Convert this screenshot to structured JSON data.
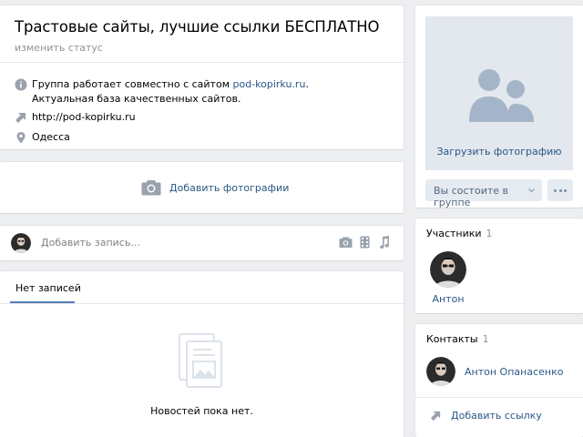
{
  "header": {
    "title": "Трастовые сайты, лучшие ссылки БЕСПЛАТНО",
    "status_link": "изменить статус",
    "description_prefix": "Группа работает совместно с сайтом ",
    "description_link": "pod-kopirku.ru",
    "description_suffix": ". Актуальная база качественных сайтов.",
    "website": "http://pod-kopirku.ru",
    "location": "Одесса"
  },
  "photos": {
    "add_label": "Добавить фотографии"
  },
  "postbox": {
    "placeholder": "Добавить запись..."
  },
  "wall": {
    "tab_label": "Нет записей",
    "empty_text": "Новостей пока нет."
  },
  "cover": {
    "upload_label": "Загрузить фотографию",
    "member_button": "Вы состоите в группе"
  },
  "members": {
    "title": "Участники",
    "count": "1",
    "items": [
      {
        "name": "Антон"
      }
    ]
  },
  "contacts": {
    "title": "Контакты",
    "count": "1",
    "items": [
      {
        "name": "Антон Опанасенко"
      }
    ],
    "add_link": "Добавить ссылку"
  },
  "colors": {
    "link": "#2a5885",
    "accent": "#5181b8",
    "background": "#edeef0",
    "icon_gray": "#99a2ad"
  },
  "icons": [
    "info-icon",
    "link-arrow-icon",
    "location-pin-icon",
    "camera-icon",
    "video-icon",
    "music-icon",
    "users-icon",
    "chevron-down-icon",
    "more-icon",
    "empty-feed-icon"
  ]
}
